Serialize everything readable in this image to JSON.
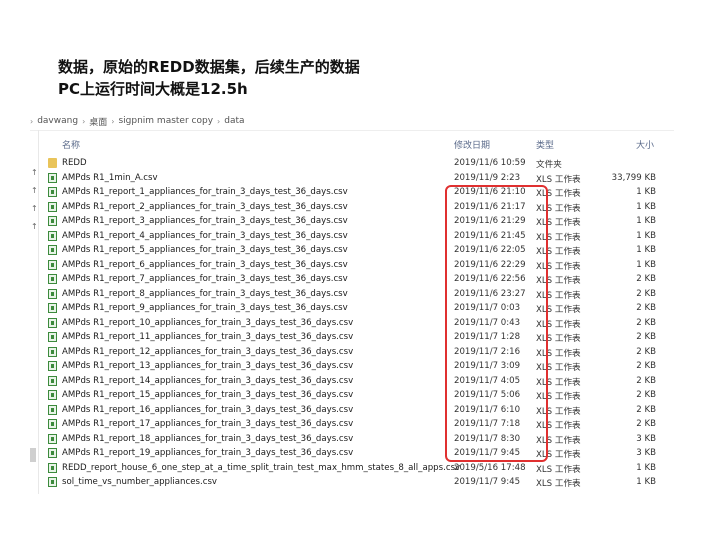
{
  "caption": {
    "line1": "数据，原始的REDD数据集，后续生产的数据",
    "line2": "PC上运行时间大概是12.5h"
  },
  "address_bar": [
    "davwang",
    "桌面",
    "sigpnim master copy",
    "data"
  ],
  "header": {
    "name": "名称",
    "modified": "修改日期",
    "type": "类型",
    "size": "大小"
  },
  "files": [
    {
      "name": "REDD",
      "date": "2019/11/6 10:59",
      "type": "文件夹",
      "size": "",
      "icon": "folder-icon"
    },
    {
      "name": "AMPds R1_1min_A.csv",
      "date": "2019/11/9 2:23",
      "type": "XLS 工作表",
      "size": "33,799 KB",
      "icon": "csv-file-icon"
    },
    {
      "name": "AMPds R1_report_1_appliances_for_train_3_days_test_36_days.csv",
      "date": "2019/11/6 21:10",
      "type": "XLS 工作表",
      "size": "1 KB",
      "icon": "csv-file-icon"
    },
    {
      "name": "AMPds R1_report_2_appliances_for_train_3_days_test_36_days.csv",
      "date": "2019/11/6 21:17",
      "type": "XLS 工作表",
      "size": "1 KB",
      "icon": "csv-file-icon"
    },
    {
      "name": "AMPds R1_report_3_appliances_for_train_3_days_test_36_days.csv",
      "date": "2019/11/6 21:29",
      "type": "XLS 工作表",
      "size": "1 KB",
      "icon": "csv-file-icon"
    },
    {
      "name": "AMPds R1_report_4_appliances_for_train_3_days_test_36_days.csv",
      "date": "2019/11/6 21:45",
      "type": "XLS 工作表",
      "size": "1 KB",
      "icon": "csv-file-icon"
    },
    {
      "name": "AMPds R1_report_5_appliances_for_train_3_days_test_36_days.csv",
      "date": "2019/11/6 22:05",
      "type": "XLS 工作表",
      "size": "1 KB",
      "icon": "csv-file-icon"
    },
    {
      "name": "AMPds R1_report_6_appliances_for_train_3_days_test_36_days.csv",
      "date": "2019/11/6 22:29",
      "type": "XLS 工作表",
      "size": "1 KB",
      "icon": "csv-file-icon"
    },
    {
      "name": "AMPds R1_report_7_appliances_for_train_3_days_test_36_days.csv",
      "date": "2019/11/6 22:56",
      "type": "XLS 工作表",
      "size": "2 KB",
      "icon": "csv-file-icon"
    },
    {
      "name": "AMPds R1_report_8_appliances_for_train_3_days_test_36_days.csv",
      "date": "2019/11/6 23:27",
      "type": "XLS 工作表",
      "size": "2 KB",
      "icon": "csv-file-icon"
    },
    {
      "name": "AMPds R1_report_9_appliances_for_train_3_days_test_36_days.csv",
      "date": "2019/11/7 0:03",
      "type": "XLS 工作表",
      "size": "2 KB",
      "icon": "csv-file-icon"
    },
    {
      "name": "AMPds R1_report_10_appliances_for_train_3_days_test_36_days.csv",
      "date": "2019/11/7 0:43",
      "type": "XLS 工作表",
      "size": "2 KB",
      "icon": "csv-file-icon"
    },
    {
      "name": "AMPds R1_report_11_appliances_for_train_3_days_test_36_days.csv",
      "date": "2019/11/7 1:28",
      "type": "XLS 工作表",
      "size": "2 KB",
      "icon": "csv-file-icon"
    },
    {
      "name": "AMPds R1_report_12_appliances_for_train_3_days_test_36_days.csv",
      "date": "2019/11/7 2:16",
      "type": "XLS 工作表",
      "size": "2 KB",
      "icon": "csv-file-icon"
    },
    {
      "name": "AMPds R1_report_13_appliances_for_train_3_days_test_36_days.csv",
      "date": "2019/11/7 3:09",
      "type": "XLS 工作表",
      "size": "2 KB",
      "icon": "csv-file-icon"
    },
    {
      "name": "AMPds R1_report_14_appliances_for_train_3_days_test_36_days.csv",
      "date": "2019/11/7 4:05",
      "type": "XLS 工作表",
      "size": "2 KB",
      "icon": "csv-file-icon"
    },
    {
      "name": "AMPds R1_report_15_appliances_for_train_3_days_test_36_days.csv",
      "date": "2019/11/7 5:06",
      "type": "XLS 工作表",
      "size": "2 KB",
      "icon": "csv-file-icon"
    },
    {
      "name": "AMPds R1_report_16_appliances_for_train_3_days_test_36_days.csv",
      "date": "2019/11/7 6:10",
      "type": "XLS 工作表",
      "size": "2 KB",
      "icon": "csv-file-icon"
    },
    {
      "name": "AMPds R1_report_17_appliances_for_train_3_days_test_36_days.csv",
      "date": "2019/11/7 7:18",
      "type": "XLS 工作表",
      "size": "2 KB",
      "icon": "csv-file-icon"
    },
    {
      "name": "AMPds R1_report_18_appliances_for_train_3_days_test_36_days.csv",
      "date": "2019/11/7 8:30",
      "type": "XLS 工作表",
      "size": "3 KB",
      "icon": "csv-file-icon"
    },
    {
      "name": "AMPds R1_report_19_appliances_for_train_3_days_test_36_days.csv",
      "date": "2019/11/7 9:45",
      "type": "XLS 工作表",
      "size": "3 KB",
      "icon": "csv-file-icon"
    },
    {
      "name": "REDD_report_house_6_one_step_at_a_time_split_train_test_max_hmm_states_8_all_apps.csv",
      "date": "2019/5/16 17:48",
      "type": "XLS 工作表",
      "size": "1 KB",
      "icon": "csv-file-icon"
    },
    {
      "name": "sol_time_vs_number_appliances.csv",
      "date": "2019/11/7 9:45",
      "type": "XLS 工作表",
      "size": "1 KB",
      "icon": "csv-file-icon"
    }
  ],
  "colors": {
    "highlight": "#e03030",
    "folder": "#e9c45a",
    "csv_icon": "#3c8a3c"
  }
}
